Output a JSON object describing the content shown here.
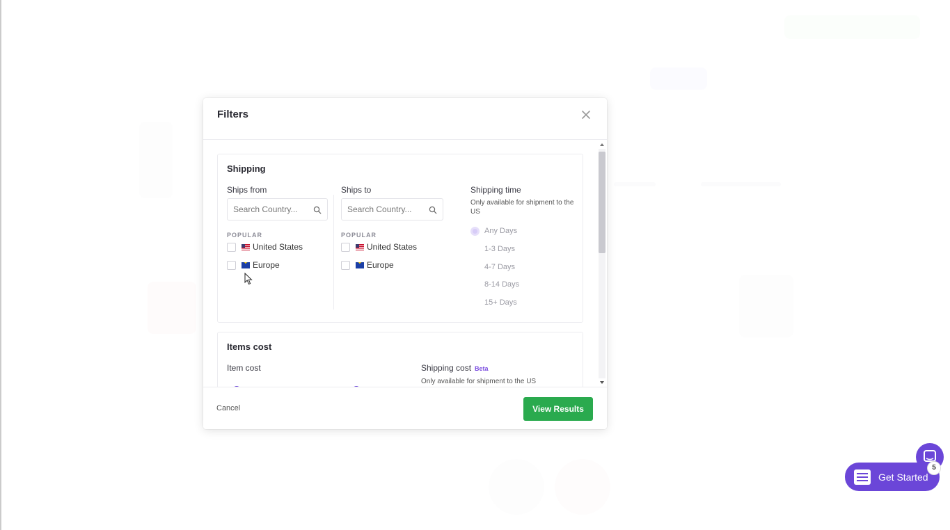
{
  "modal": {
    "title": "Filters",
    "shipping": {
      "title": "Shipping",
      "ships_from": {
        "label": "Ships from",
        "search_placeholder": "Search Country...",
        "popular_label": "POPULAR",
        "options": [
          "United States",
          "Europe"
        ]
      },
      "ships_to": {
        "label": "Ships to",
        "search_placeholder": "Search Country...",
        "popular_label": "POPULAR",
        "options": [
          "United States",
          "Europe"
        ]
      },
      "shipping_time": {
        "label": "Shipping time",
        "note": "Only available for shipment to the US",
        "options": [
          "Any Days",
          "1-3 Days",
          "4-7 Days",
          "8-14 Days",
          "15+ Days"
        ],
        "selected": "Any Days"
      }
    },
    "items_cost": {
      "title": "Items cost",
      "item_cost_label": "Item cost",
      "shipping_cost_label": "Shipping cost",
      "beta_badge": "Beta",
      "shipping_cost_note": "Only available for shipment to the US"
    },
    "footer": {
      "cancel_label": "Cancel",
      "view_results_label": "View Results"
    }
  },
  "widget": {
    "get_started_label": "Get Started",
    "badge_count": "5"
  },
  "colors": {
    "accent": "#6b46d8",
    "primary_button": "#2aaa4e"
  }
}
